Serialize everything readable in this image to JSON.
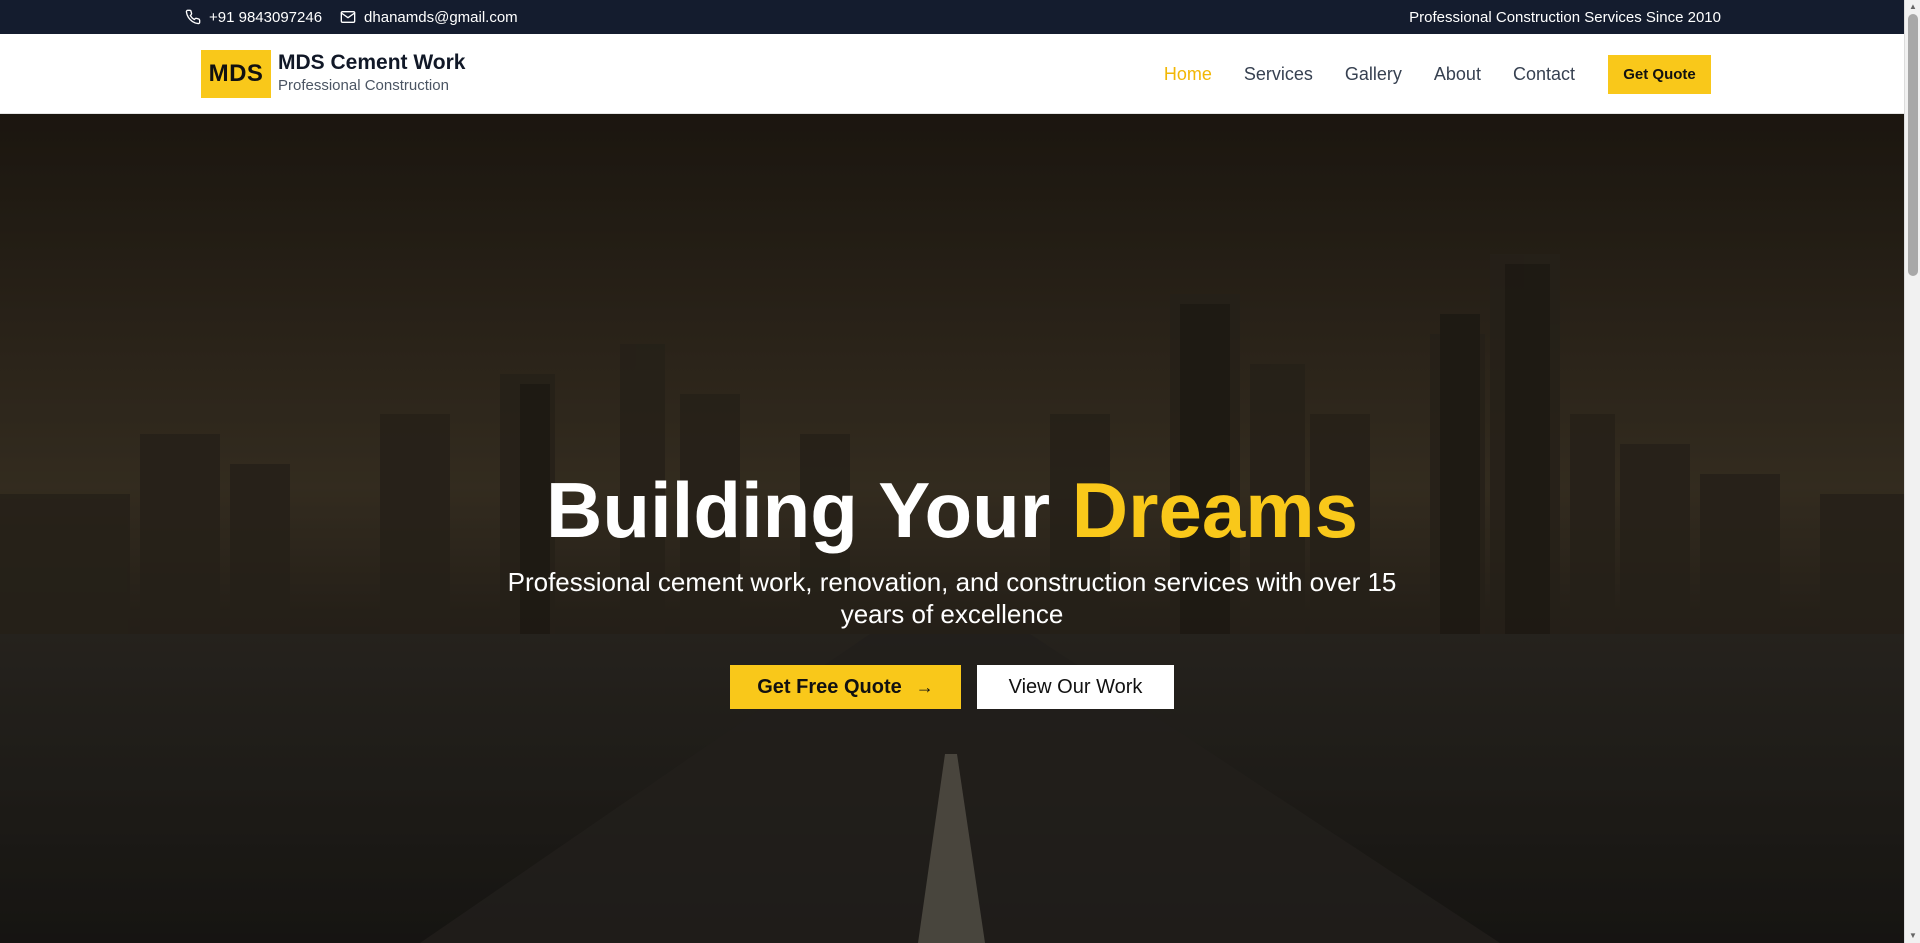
{
  "topbar": {
    "phone": "+91 9843097246",
    "email": "dhanamds@gmail.com",
    "tagline": "Professional Construction Services Since 2010",
    "icons": {
      "phone": "phone-icon",
      "email": "mail-icon"
    }
  },
  "header": {
    "logo": "MDS",
    "brand_name": "MDS Cement Work",
    "brand_sub": "Professional Construction",
    "nav": [
      {
        "label": "Home",
        "active": true
      },
      {
        "label": "Services",
        "active": false
      },
      {
        "label": "Gallery",
        "active": false
      },
      {
        "label": "About",
        "active": false
      },
      {
        "label": "Contact",
        "active": false
      }
    ],
    "quote_button": "Get Quote"
  },
  "hero": {
    "title_main": "Building Your ",
    "title_accent": "Dreams",
    "subtitle": "Professional cement work, renovation, and construction services with over 15 years of excellence",
    "primary_button": "Get Free Quote",
    "secondary_button": "View Our Work",
    "background": "city-skyline-road"
  },
  "colors": {
    "accent": "#f9c81a",
    "topbar_bg": "#141c2e",
    "nav_active": "#f2b705"
  }
}
